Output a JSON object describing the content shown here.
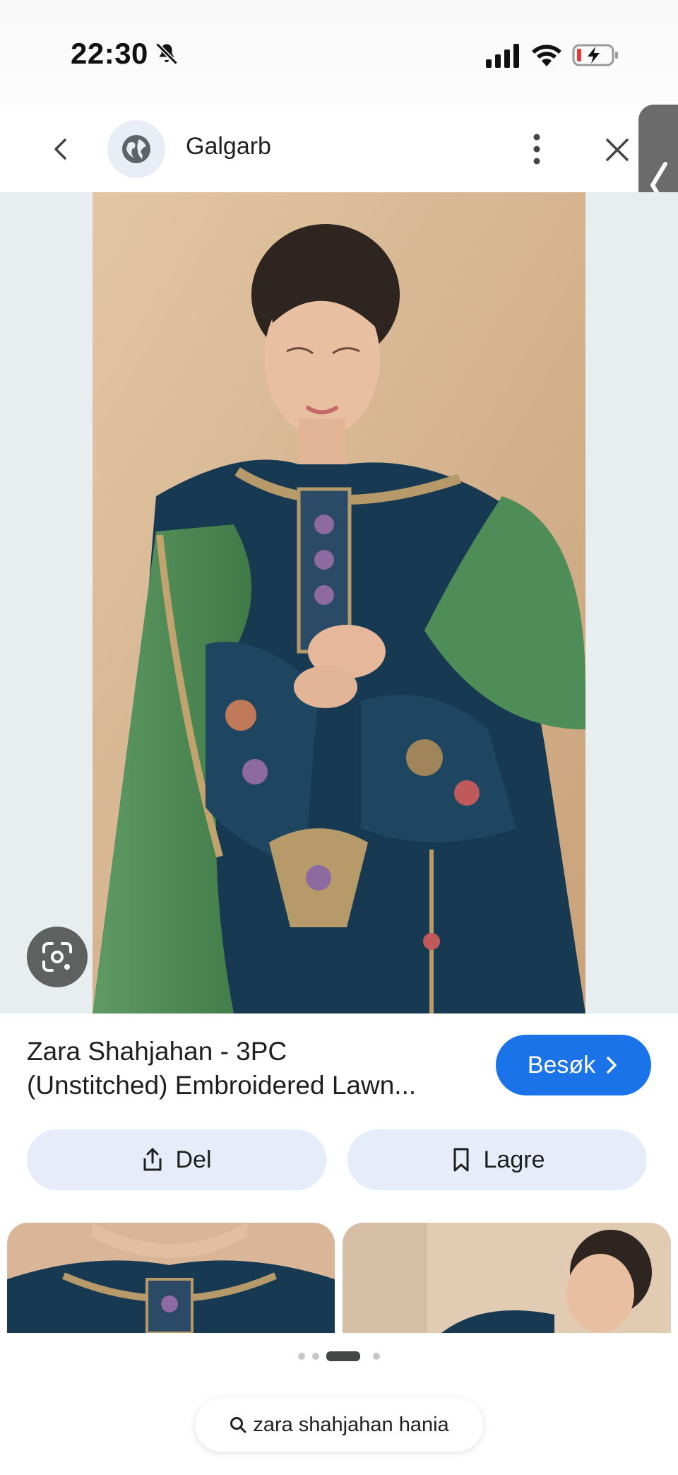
{
  "status_bar": {
    "time": "22:30"
  },
  "header": {
    "site_name": "Galgarb"
  },
  "result": {
    "title_line1": "Zara Shahjahan - 3PC",
    "title_line2": "(Unstitched) Embroidered Lawn...",
    "visit_label": "Besøk"
  },
  "actions": {
    "share_label": "Del",
    "save_label": "Lagre"
  },
  "carousel": {
    "dots": 4,
    "active_index": 2
  },
  "search": {
    "query": "zara shahjahan hania"
  },
  "colors": {
    "accent": "#1a73e8",
    "button_bg": "#e6ecf8",
    "battery_low": "#e53935"
  }
}
